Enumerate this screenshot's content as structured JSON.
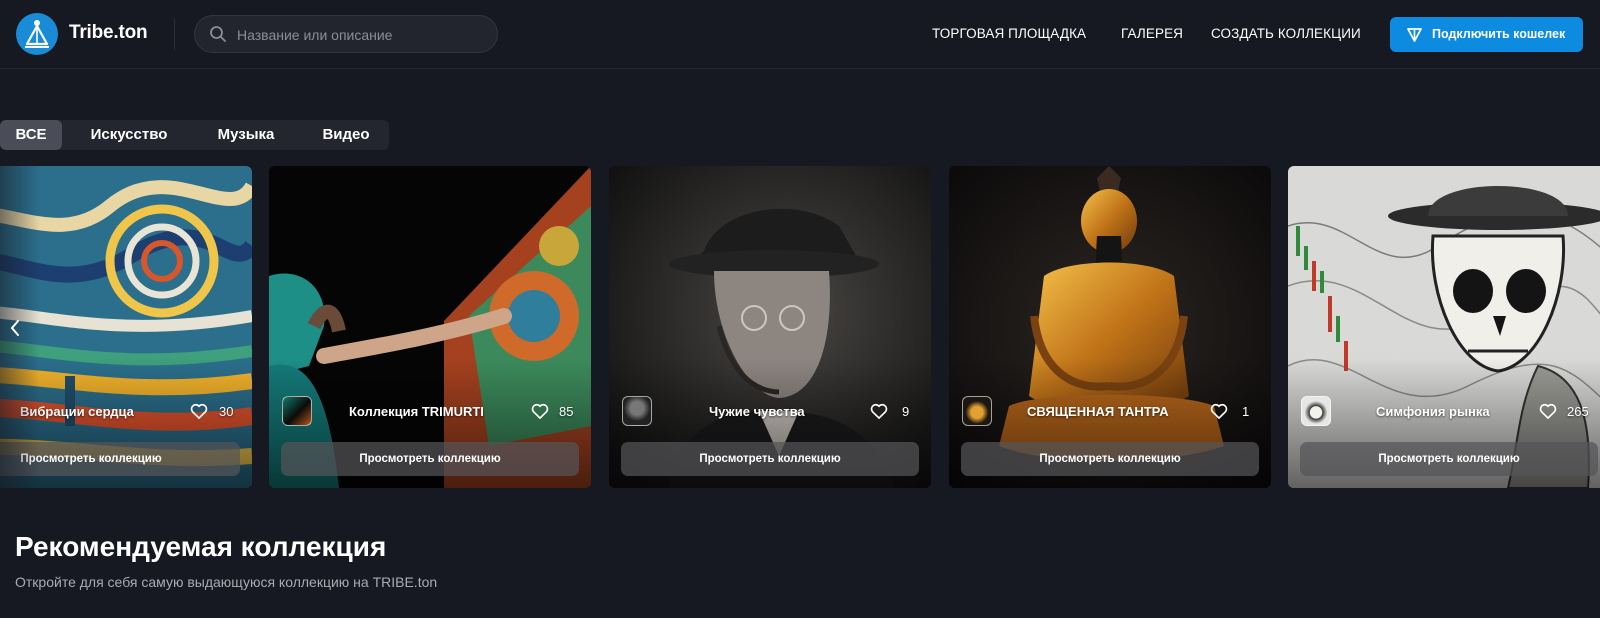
{
  "header": {
    "logo_text": "Tribe.ton",
    "search_placeholder": "Название или описание",
    "nav": [
      "ТОРГОВАЯ ПЛОЩАДКА",
      "ГАЛЕРЕЯ",
      "СОЗДАТЬ КОЛЛЕКЦИИ"
    ],
    "connect_label": "Подключить кошелек"
  },
  "tabs": [
    "ВСЕ",
    "Искусство",
    "Музыка",
    "Видео"
  ],
  "active_tab": "ВСЕ",
  "carousel": {
    "cards": [
      {
        "title": "Вибрации сердца",
        "likes": "30",
        "button": "Просмотреть коллекцию",
        "has_thumb": false
      },
      {
        "title": "Коллекция TRIMURTI",
        "likes": "85",
        "button": "Просмотреть коллекцию",
        "has_thumb": true
      },
      {
        "title": "Чужие чувства",
        "likes": "9",
        "button": "Просмотреть коллекцию",
        "has_thumb": true
      },
      {
        "title": "СВЯЩЕННАЯ ТАНТРА",
        "likes": "1",
        "button": "Просмотреть коллекцию",
        "has_thumb": true
      },
      {
        "title": "Симфония рынка",
        "likes": "265",
        "button": "Просмотреть коллекцию",
        "has_thumb": true
      }
    ]
  },
  "featured": {
    "title": "Рекомендуемая коллекция",
    "subtitle": "Откройте для себя самую выдающуюся коллекцию на TRIBE.ton"
  },
  "colors": {
    "background": "#161822",
    "accent": "#0d8be0",
    "tab_bg": "#23252f",
    "tab_active": "#4a4c57"
  },
  "icons": [
    "ton-logo-icon",
    "search-icon",
    "ton-diamond-icon",
    "heart-icon",
    "chevron-left-icon"
  ]
}
